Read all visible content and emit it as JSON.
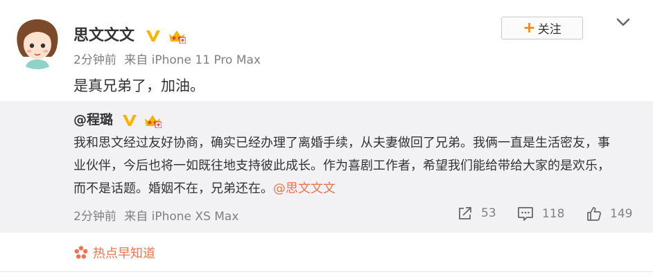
{
  "post": {
    "author": "思文文文",
    "time": "2分钟前",
    "source": "来自 iPhone 11 Pro Max",
    "text": "是真兄弟了，加油。",
    "follow_label": "关注",
    "follow_icon": "plus-icon",
    "menu_icon": "chevron-down-icon"
  },
  "repost": {
    "author": "@程璐",
    "text_before": "我和思文经过友好协商，确实已经办理了离婚手续，从夫妻做回了兄弟。我俩一直是生活密友，事业伙伴，今后也将一如既往地支持彼此成长。作为喜剧工作者，希望我们能给带给大家的是欢乐，而不是话题。婚姻不在，兄弟还在。",
    "mention": "@思文文文",
    "time": "2分钟前",
    "source": "来自 iPhone XS Max",
    "shares": "53",
    "comments": "118",
    "likes": "149"
  },
  "hot_topic": {
    "label": "热点早知道",
    "icon": "flower-icon"
  },
  "colors": {
    "accent": "#eb7350",
    "follow_plus": "#ff8200",
    "verified": "#f7b500",
    "repost_bg": "#f2f2f5",
    "meta_text": "#808080"
  }
}
